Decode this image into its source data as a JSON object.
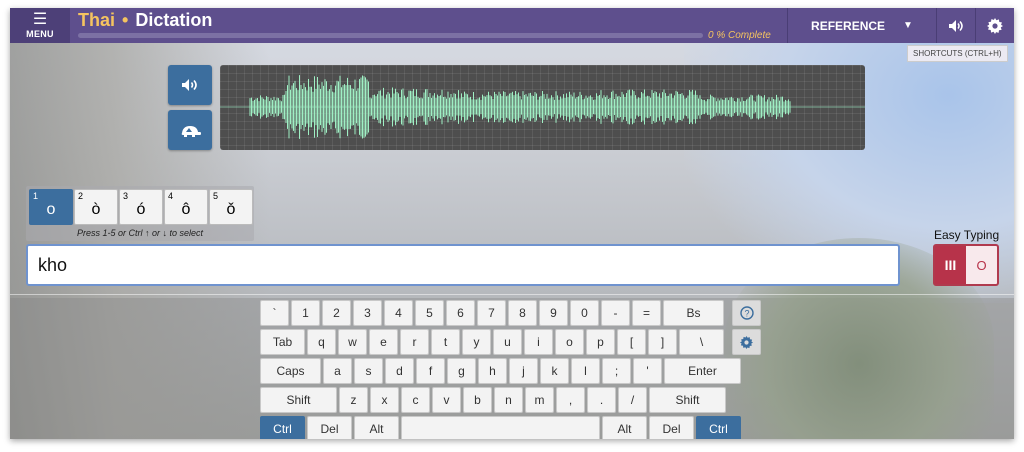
{
  "header": {
    "menu_label": "MENU",
    "language": "Thai",
    "separator": "•",
    "mode": "Dictation",
    "progress_text": "0 % Complete",
    "progress_fraction": 0.0,
    "reference_label": "REFERENCE",
    "shortcuts_tooltip": "SHORTCUTS (CTRL+H)",
    "icons": {
      "menu": "hamburger-icon",
      "reference_caret": "caret-down-icon",
      "volume": "volume-icon",
      "settings": "gear-icon"
    }
  },
  "audio": {
    "play_icon": "speaker-icon",
    "slow_icon": "turtle-icon",
    "waveform_color": "#9ff0c4"
  },
  "tones": {
    "options": [
      {
        "num": "1",
        "char": "o"
      },
      {
        "num": "2",
        "char": "ò"
      },
      {
        "num": "3",
        "char": "ó"
      },
      {
        "num": "4",
        "char": "ô"
      },
      {
        "num": "5",
        "char": "ǒ"
      }
    ],
    "selected_index": 0,
    "hint": "Press 1-5 or Ctrl ↑ or ↓ to select"
  },
  "answer": {
    "value": "kho"
  },
  "easy_typing": {
    "label": "Easy Typing",
    "on_glyph": "III",
    "off_glyph": "O",
    "state": "on"
  },
  "keyboard": {
    "row1": [
      "`",
      "1",
      "2",
      "3",
      "4",
      "5",
      "6",
      "7",
      "8",
      "9",
      "0",
      "-",
      "=",
      "Bs"
    ],
    "row2": [
      "Tab",
      "q",
      "w",
      "e",
      "r",
      "t",
      "y",
      "u",
      "i",
      "o",
      "p",
      "[",
      "]",
      "\\"
    ],
    "row3": [
      "Caps",
      "a",
      "s",
      "d",
      "f",
      "g",
      "h",
      "j",
      "k",
      "l",
      ";",
      "'",
      "Enter"
    ],
    "row4": [
      "Shift",
      "z",
      "x",
      "c",
      "v",
      "b",
      "n",
      "m",
      ",",
      ".",
      "/",
      "Shift"
    ],
    "row5": [
      "Ctrl",
      "Del",
      "Alt",
      "",
      "Alt",
      "Del",
      "Ctrl"
    ],
    "help_icon": "question-circle-icon",
    "settings_icon": "gear-icon"
  },
  "colors": {
    "header": "#5e4f8d",
    "accent": "#f5c460",
    "button": "#3c6e9e",
    "easy_typing": "#b7334a"
  }
}
